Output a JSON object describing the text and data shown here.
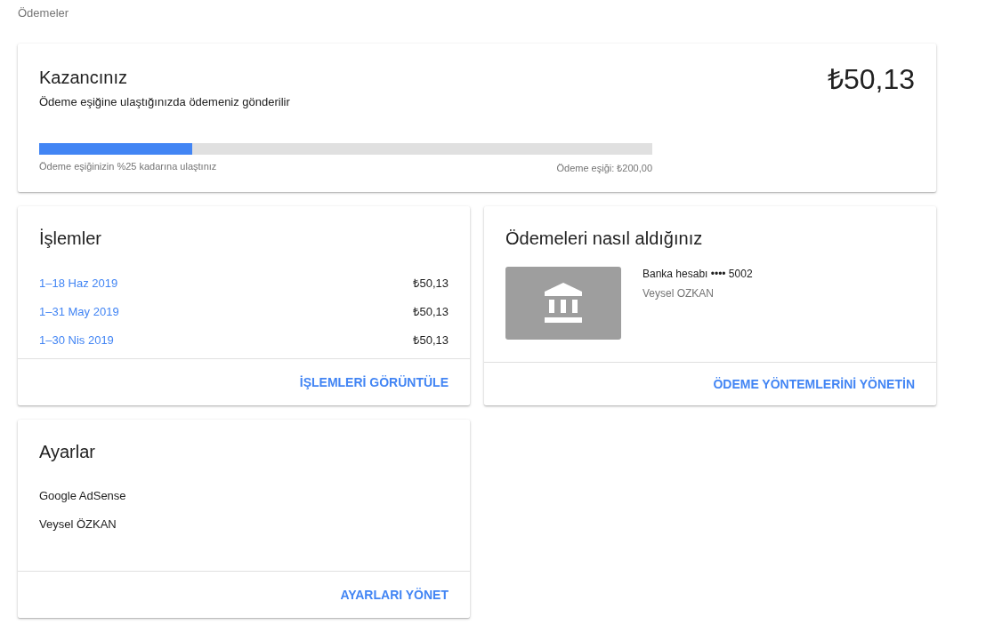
{
  "breadcrumb": "Ödemeler",
  "earnings": {
    "title": "Kazancınız",
    "subtitle": "Ödeme eşiğine ulaştığınızda ödemeniz gönderilir",
    "amount": "₺50,13",
    "level": 0.25,
    "progress_label": "Ödeme eşiğinizin %25 kadarına ulaştınız",
    "threshold_label": "Ödeme eşiği: ₺200,00"
  },
  "transactions": {
    "title": "İşlemler",
    "rows": [
      {
        "period": "1–18 Haz 2019",
        "amount": "₺50,13"
      },
      {
        "period": "1–31 May 2019",
        "amount": "₺50,13"
      },
      {
        "period": "1–30 Nis 2019",
        "amount": "₺50,13"
      }
    ],
    "action": "İŞLEMLERİ GÖRÜNTÜLE"
  },
  "payment_method": {
    "title": "Ödemeleri nasıl aldığınız",
    "account": "Banka hesabı •••• 5002",
    "holder": "Veysel OZKAN",
    "action": "ÖDEME YÖNTEMLERİNİ YÖNETİN"
  },
  "settings": {
    "title": "Ayarlar",
    "items": [
      "Google AdSense",
      "Veysel ÖZKAN"
    ],
    "action": "AYARLARI YÖNET"
  }
}
